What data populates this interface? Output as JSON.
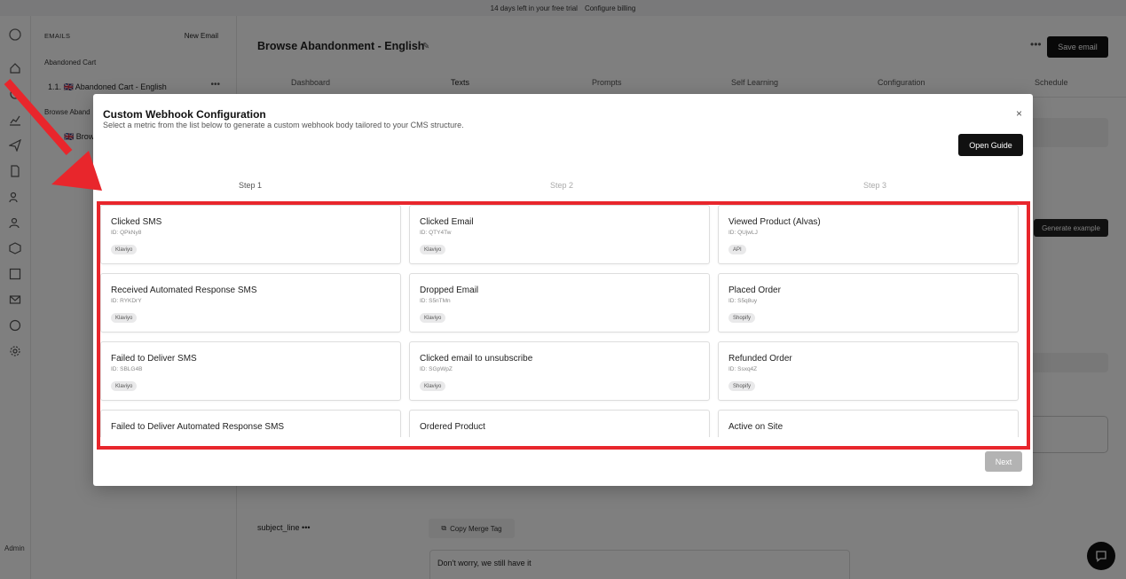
{
  "banner": {
    "trial_text": "14 days left in your free trial",
    "billing_link": "Configure billing"
  },
  "rail": {
    "icons": [
      "logo-icon",
      "home-icon",
      "emails-icon",
      "analytics-icon",
      "send-icon",
      "document-icon",
      "users-icon",
      "group-icon",
      "package-icon",
      "gallery-icon",
      "mail-icon",
      "palette-icon",
      "settings-icon"
    ],
    "admin_label": "Admin"
  },
  "email_panel": {
    "heading": "EMAILS",
    "new_email": "New Email",
    "group1": "Abandoned Cart",
    "item1": "1.1. 🇬🇧 Abandoned Cart - English",
    "group2": "Browse Aband",
    "item2": "🇬🇧 Brow"
  },
  "main": {
    "title": "Browse Abandonment - English",
    "save_label": "Save email",
    "tabs": [
      "Dashboard",
      "Texts",
      "Prompts",
      "Self Learning",
      "Configuration",
      "Schedule"
    ],
    "generate_label": "Generate example",
    "subject_label": "subject_line",
    "copy_merge_label": "Copy Merge Tag",
    "preview_text": "Don't worry, we still have it"
  },
  "modal": {
    "title": "Custom Webhook Configuration",
    "subtitle": "Select a metric from the list below to generate a custom webhook body tailored to your CMS structure.",
    "close": "×",
    "guide_label": "Open Guide",
    "steps": [
      "Step 1",
      "Step 2",
      "Step 3"
    ],
    "next_label": "Next",
    "metrics": [
      {
        "name": "Clicked SMS",
        "id": "ID: QPkNy8",
        "source": "Klaviyo"
      },
      {
        "name": "Clicked Email",
        "id": "ID: QTY4Tw",
        "source": "Klaviyo"
      },
      {
        "name": "Viewed Product (Alvas)",
        "id": "ID: QUjwLJ",
        "source": "API"
      },
      {
        "name": "Received Automated Response SMS",
        "id": "ID: RYKDrY",
        "source": "Klaviyo"
      },
      {
        "name": "Dropped Email",
        "id": "ID: S5nTMn",
        "source": "Klaviyo"
      },
      {
        "name": "Placed Order",
        "id": "ID: S5q8uy",
        "source": "Shopify"
      },
      {
        "name": "Failed to Deliver SMS",
        "id": "ID: SBLG4B",
        "source": "Klaviyo"
      },
      {
        "name": "Clicked email to unsubscribe",
        "id": "ID: SGpWpZ",
        "source": "Klaviyo"
      },
      {
        "name": "Refunded Order",
        "id": "ID: Ssxq4Z",
        "source": "Shopify"
      },
      {
        "name": "Failed to Deliver Automated Response SMS",
        "id": "",
        "source": ""
      },
      {
        "name": "Ordered Product",
        "id": "",
        "source": ""
      },
      {
        "name": "Active on Site",
        "id": "",
        "source": ""
      }
    ]
  },
  "colors": {
    "highlight": "#e8262c",
    "primary_button": "#111111",
    "disabled_button": "#b3b3b3"
  }
}
